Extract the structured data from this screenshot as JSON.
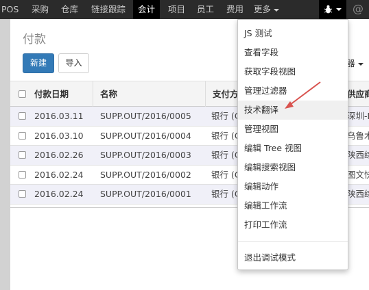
{
  "nav": {
    "items": [
      "POS",
      "采购",
      "仓库",
      "链接跟踪",
      "会计",
      "项目",
      "员工",
      "费用",
      "更多"
    ],
    "more_label": "更多",
    "active_index": 4
  },
  "page": {
    "title": "付款",
    "create_button": "新建",
    "import_button": "导入",
    "filter_button_partial": "器"
  },
  "table": {
    "headers": [
      "付款日期",
      "名称",
      "支付方",
      "供应商"
    ],
    "rows": [
      {
        "date": "2016.03.11",
        "name": "SUPP.OUT/2016/0005",
        "journal": "银行 (C",
        "partner": "深圳-F"
      },
      {
        "date": "2016.03.10",
        "name": "SUPP.OUT/2016/0004",
        "journal": "银行 (C",
        "partner": "乌鲁木"
      },
      {
        "date": "2016.02.26",
        "name": "SUPP.OUT/2016/0003",
        "journal": "银行 (C",
        "partner": "陕西综"
      },
      {
        "date": "2016.02.24",
        "name": "SUPP.OUT/2016/0002",
        "journal": "银行 (C",
        "partner": "图文快"
      },
      {
        "date": "2016.02.24",
        "name": "SUPP.OUT/2016/0001",
        "journal": "银行 (C",
        "partner": "陕西综"
      }
    ]
  },
  "debug_menu": {
    "items": [
      "JS 测试",
      "查看字段",
      "获取字段视图",
      "管理过滤器",
      "技术翻译",
      "管理视图",
      "编辑 Tree 视图",
      "编辑搜索视图",
      "编辑动作",
      "编辑工作流",
      "打印工作流"
    ],
    "exit_label": "退出调试模式",
    "highlighted_index": 4
  },
  "icons": {
    "debug": "bug-icon",
    "user": "at-icon"
  },
  "colors": {
    "topbar": "#2b2b2b",
    "primary": "#337ab7",
    "arrow": "#d9534f"
  }
}
